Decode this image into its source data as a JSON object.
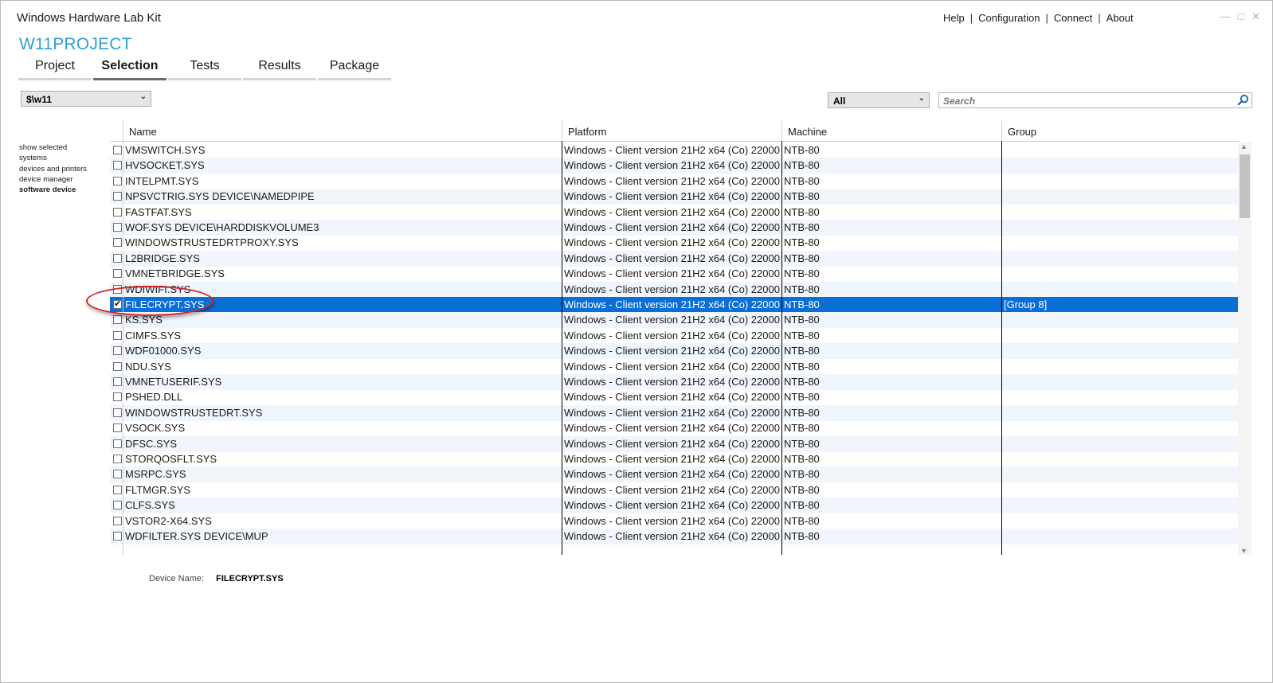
{
  "window": {
    "title": "Windows Hardware Lab Kit"
  },
  "top_links": [
    "Help",
    "Configuration",
    "Connect",
    "About"
  ],
  "window_controls": [
    "minimize",
    "maximize",
    "close"
  ],
  "project": {
    "name": "W11PROJECT"
  },
  "tabs": [
    {
      "label": "Project",
      "active": false
    },
    {
      "label": "Selection",
      "active": true
    },
    {
      "label": "Tests",
      "active": false
    },
    {
      "label": "Results",
      "active": false
    },
    {
      "label": "Package",
      "active": false
    }
  ],
  "pool_select": {
    "value": "$\\w11"
  },
  "filter_select": {
    "value": "All"
  },
  "search": {
    "placeholder": "Search",
    "icon": "search-icon"
  },
  "side_nav": [
    {
      "label": "show selected",
      "active": false
    },
    {
      "label": "systems",
      "active": false
    },
    {
      "label": "devices and printers",
      "active": false
    },
    {
      "label": "device manager",
      "active": false
    },
    {
      "label": "software device",
      "active": true
    }
  ],
  "table": {
    "columns": [
      "Name",
      "Platform",
      "Machine",
      "Group"
    ],
    "rows": [
      {
        "name": "VMSWITCH.SYS",
        "platform": "Windows - Client version 21H2 x64 (Co) 22000",
        "machine": "NTB-80",
        "group": "",
        "checked": false,
        "selected": false
      },
      {
        "name": "HVSOCKET.SYS",
        "platform": "Windows - Client version 21H2 x64 (Co) 22000",
        "machine": "NTB-80",
        "group": "",
        "checked": false,
        "selected": false
      },
      {
        "name": "INTELPMT.SYS",
        "platform": "Windows - Client version 21H2 x64 (Co) 22000",
        "machine": "NTB-80",
        "group": "",
        "checked": false,
        "selected": false
      },
      {
        "name": "NPSVCTRIG.SYS DEVICE\\NAMEDPIPE",
        "platform": "Windows - Client version 21H2 x64 (Co) 22000",
        "machine": "NTB-80",
        "group": "",
        "checked": false,
        "selected": false
      },
      {
        "name": "FASTFAT.SYS",
        "platform": "Windows - Client version 21H2 x64 (Co) 22000",
        "machine": "NTB-80",
        "group": "",
        "checked": false,
        "selected": false
      },
      {
        "name": "WOF.SYS DEVICE\\HARDDISKVOLUME3",
        "platform": "Windows - Client version 21H2 x64 (Co) 22000",
        "machine": "NTB-80",
        "group": "",
        "checked": false,
        "selected": false
      },
      {
        "name": "WINDOWSTRUSTEDRTPROXY.SYS",
        "platform": "Windows - Client version 21H2 x64 (Co) 22000",
        "machine": "NTB-80",
        "group": "",
        "checked": false,
        "selected": false
      },
      {
        "name": "L2BRIDGE.SYS",
        "platform": "Windows - Client version 21H2 x64 (Co) 22000",
        "machine": "NTB-80",
        "group": "",
        "checked": false,
        "selected": false
      },
      {
        "name": "VMNETBRIDGE.SYS",
        "platform": "Windows - Client version 21H2 x64 (Co) 22000",
        "machine": "NTB-80",
        "group": "",
        "checked": false,
        "selected": false
      },
      {
        "name": "WDIWIFI.SYS",
        "platform": "Windows - Client version 21H2 x64 (Co) 22000",
        "machine": "NTB-80",
        "group": "",
        "checked": false,
        "selected": false
      },
      {
        "name": "FILECRYPT.SYS",
        "platform": "Windows - Client version 21H2 x64 (Co) 22000",
        "machine": "NTB-80",
        "group": "[Group 8]",
        "checked": true,
        "selected": true
      },
      {
        "name": "KS.SYS",
        "platform": "Windows - Client version 21H2 x64 (Co) 22000",
        "machine": "NTB-80",
        "group": "",
        "checked": false,
        "selected": false
      },
      {
        "name": "CIMFS.SYS",
        "platform": "Windows - Client version 21H2 x64 (Co) 22000",
        "machine": "NTB-80",
        "group": "",
        "checked": false,
        "selected": false
      },
      {
        "name": "WDF01000.SYS",
        "platform": "Windows - Client version 21H2 x64 (Co) 22000",
        "machine": "NTB-80",
        "group": "",
        "checked": false,
        "selected": false
      },
      {
        "name": "NDU.SYS",
        "platform": "Windows - Client version 21H2 x64 (Co) 22000",
        "machine": "NTB-80",
        "group": "",
        "checked": false,
        "selected": false
      },
      {
        "name": "VMNETUSERIF.SYS",
        "platform": "Windows - Client version 21H2 x64 (Co) 22000",
        "machine": "NTB-80",
        "group": "",
        "checked": false,
        "selected": false
      },
      {
        "name": "PSHED.DLL",
        "platform": "Windows - Client version 21H2 x64 (Co) 22000",
        "machine": "NTB-80",
        "group": "",
        "checked": false,
        "selected": false
      },
      {
        "name": "WINDOWSTRUSTEDRT.SYS",
        "platform": "Windows - Client version 21H2 x64 (Co) 22000",
        "machine": "NTB-80",
        "group": "",
        "checked": false,
        "selected": false
      },
      {
        "name": "VSOCK.SYS",
        "platform": "Windows - Client version 21H2 x64 (Co) 22000",
        "machine": "NTB-80",
        "group": "",
        "checked": false,
        "selected": false
      },
      {
        "name": "DFSC.SYS",
        "platform": "Windows - Client version 21H2 x64 (Co) 22000",
        "machine": "NTB-80",
        "group": "",
        "checked": false,
        "selected": false
      },
      {
        "name": "STORQOSFLT.SYS",
        "platform": "Windows - Client version 21H2 x64 (Co) 22000",
        "machine": "NTB-80",
        "group": "",
        "checked": false,
        "selected": false
      },
      {
        "name": "MSRPC.SYS",
        "platform": "Windows - Client version 21H2 x64 (Co) 22000",
        "machine": "NTB-80",
        "group": "",
        "checked": false,
        "selected": false
      },
      {
        "name": "FLTMGR.SYS",
        "platform": "Windows - Client version 21H2 x64 (Co) 22000",
        "machine": "NTB-80",
        "group": "",
        "checked": false,
        "selected": false
      },
      {
        "name": "CLFS.SYS",
        "platform": "Windows - Client version 21H2 x64 (Co) 22000",
        "machine": "NTB-80",
        "group": "",
        "checked": false,
        "selected": false
      },
      {
        "name": "VSTOR2-X64.SYS",
        "platform": "Windows - Client version 21H2 x64 (Co) 22000",
        "machine": "NTB-80",
        "group": "",
        "checked": false,
        "selected": false
      },
      {
        "name": "WDFILTER.SYS DEVICE\\MUP",
        "platform": "Windows - Client version 21H2 x64 (Co) 22000",
        "machine": "NTB-80",
        "group": "",
        "checked": false,
        "selected": false
      }
    ]
  },
  "details": {
    "device_name_label": "Device Name:",
    "device_name_value": "FILECRYPT.SYS"
  },
  "colors": {
    "accent": "#2e9fd8",
    "selection": "#0a6ed6",
    "alt_row": "#f0f6fb",
    "annotation_ring": "#d61f26"
  }
}
